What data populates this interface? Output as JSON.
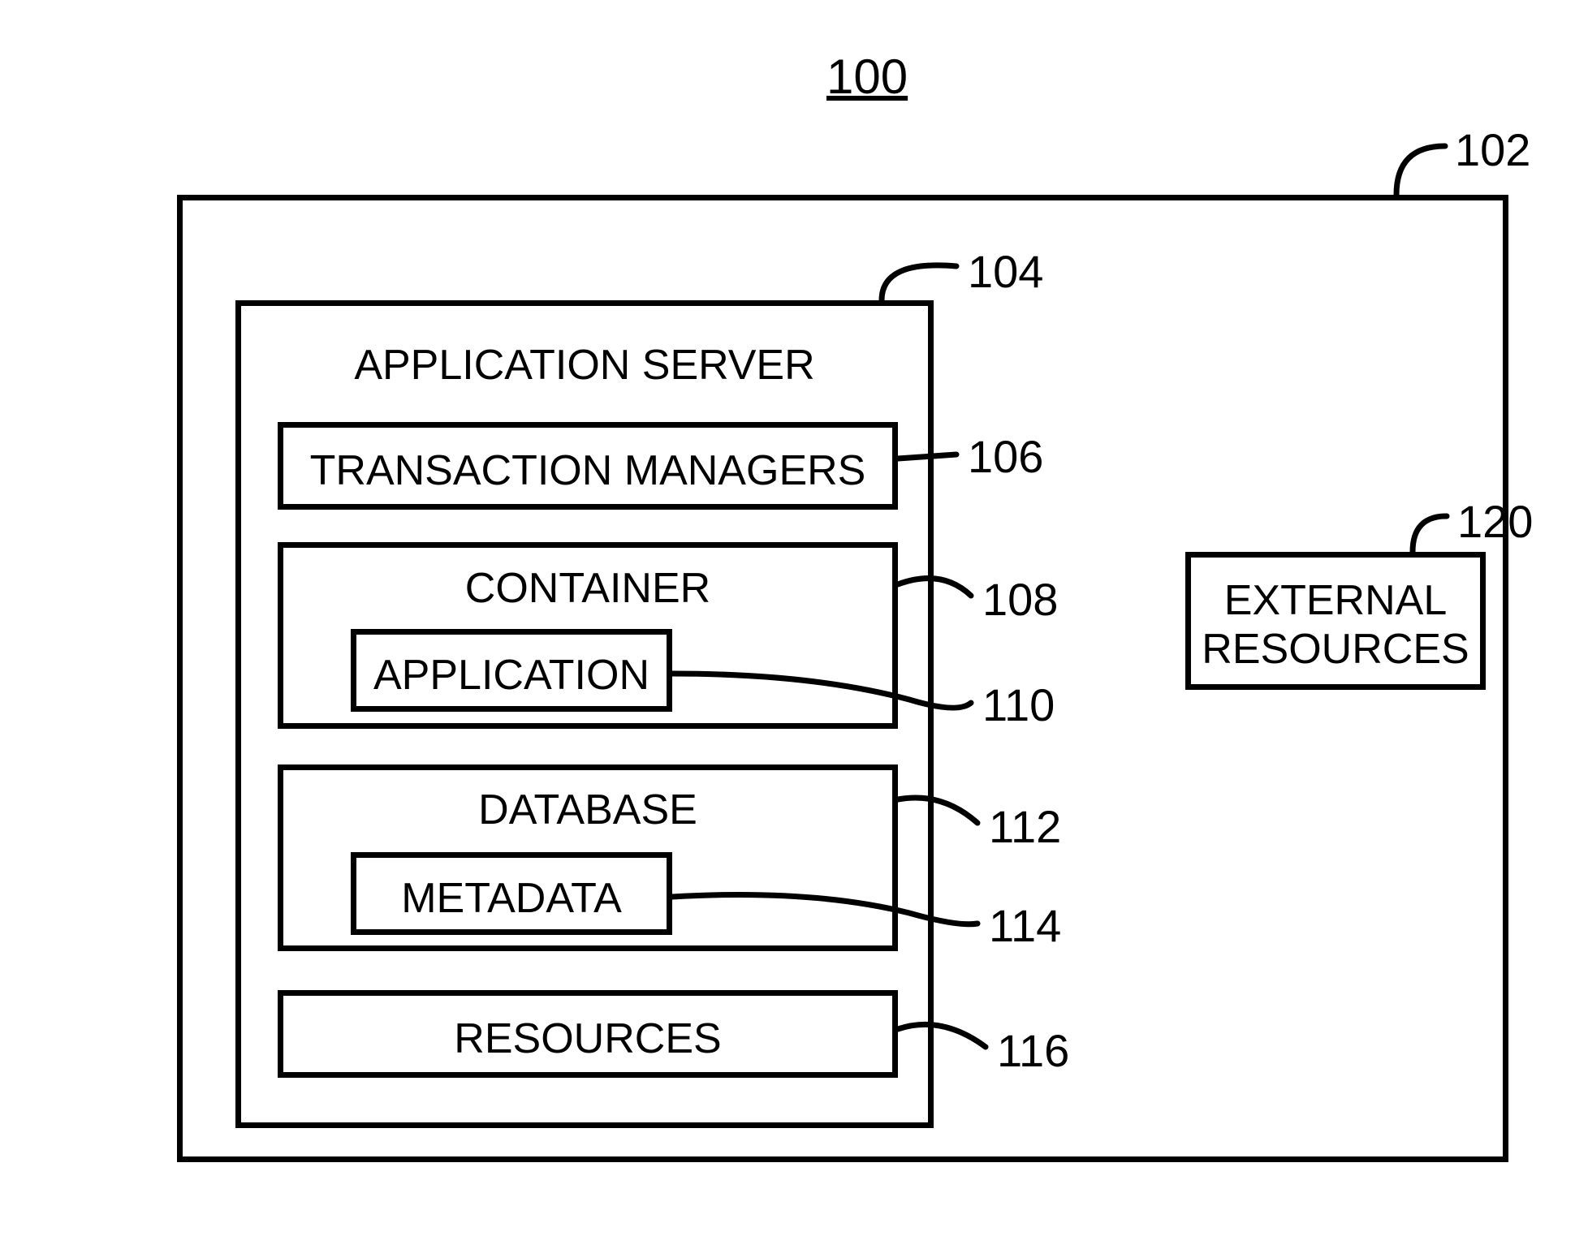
{
  "title_ref": "100",
  "outer": {
    "ref": "102"
  },
  "app_server": {
    "title": "APPLICATION SERVER",
    "ref": "104",
    "txn_managers": {
      "label": "TRANSACTION MANAGERS",
      "ref": "106"
    },
    "container": {
      "label": "CONTAINER",
      "ref": "108",
      "application": {
        "label": "APPLICATION",
        "ref": "110"
      }
    },
    "database": {
      "label": "DATABASE",
      "ref": "112",
      "metadata": {
        "label": "METADATA",
        "ref": "114"
      }
    },
    "resources": {
      "label": "RESOURCES",
      "ref": "116"
    }
  },
  "external_resources": {
    "line1": "EXTERNAL",
    "line2": "RESOURCES",
    "ref": "120"
  }
}
